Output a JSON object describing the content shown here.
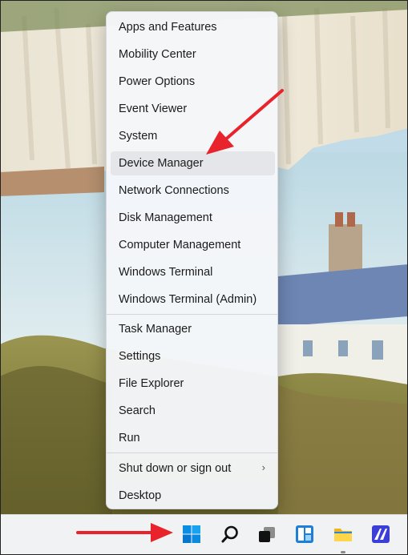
{
  "menu": {
    "items": [
      {
        "label": "Apps and Features"
      },
      {
        "label": "Mobility Center"
      },
      {
        "label": "Power Options"
      },
      {
        "label": "Event Viewer"
      },
      {
        "label": "System"
      },
      {
        "label": "Device Manager"
      },
      {
        "label": "Network Connections"
      },
      {
        "label": "Disk Management"
      },
      {
        "label": "Computer Management"
      },
      {
        "label": "Windows Terminal"
      },
      {
        "label": "Windows Terminal (Admin)"
      },
      {
        "label": "Task Manager"
      },
      {
        "label": "Settings"
      },
      {
        "label": "File Explorer"
      },
      {
        "label": "Search"
      },
      {
        "label": "Run"
      },
      {
        "label": "Shut down or sign out",
        "submenu_indicator": "›"
      },
      {
        "label": "Desktop"
      }
    ]
  },
  "taskbar": {
    "icons": [
      "windows-start-icon",
      "search-icon",
      "task-view-icon",
      "widgets-icon",
      "file-explorer-icon",
      "app-icon"
    ]
  },
  "annotations": {
    "arrows": [
      "red-arrow-to-device-manager",
      "red-arrow-to-start-button"
    ],
    "color": "#e8232b"
  },
  "colors": {
    "accent": "#0067c0",
    "menu_bg": "#f4f6f9"
  }
}
